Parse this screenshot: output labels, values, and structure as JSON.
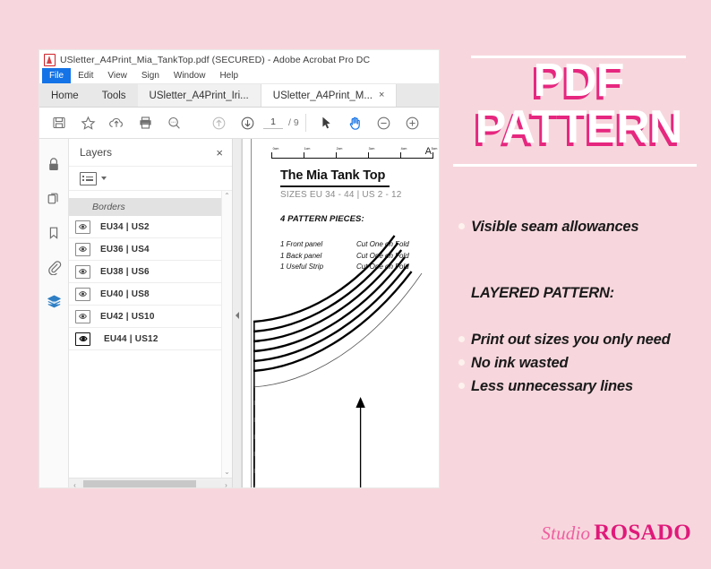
{
  "canvas": {
    "bg_color": "#f7d7dd"
  },
  "acrobat": {
    "titlebar": {
      "icon": "acrobat-logo",
      "text": "USletter_A4Print_Mia_TankTop.pdf (SECURED) - Adobe Acrobat Pro DC"
    },
    "menu": [
      {
        "label": "File",
        "active": true
      },
      {
        "label": "Edit",
        "active": false
      },
      {
        "label": "View",
        "active": false
      },
      {
        "label": "Sign",
        "active": false
      },
      {
        "label": "Window",
        "active": false
      },
      {
        "label": "Help",
        "active": false
      }
    ],
    "tabs": [
      {
        "label": "Home",
        "type": "flat",
        "active": false,
        "closable": false
      },
      {
        "label": "Tools",
        "type": "flat",
        "active": false,
        "closable": false
      },
      {
        "label": "USletter_A4Print_Iri...",
        "type": "doc",
        "active": false,
        "closable": false
      },
      {
        "label": "USletter_A4Print_M...",
        "type": "doc",
        "active": true,
        "closable": true,
        "close_glyph": "×"
      }
    ],
    "toolbar": {
      "icons": [
        "save-icon",
        "star-icon",
        "cloud-upload-icon",
        "print-icon",
        "search-icon",
        "page-up-icon",
        "page-down-icon"
      ],
      "page_current": "1",
      "page_total": "/ 9",
      "tools": [
        {
          "name": "select-tool",
          "active": false
        },
        {
          "name": "hand-tool",
          "active": true
        },
        {
          "name": "zoom-out-tool",
          "active": false
        },
        {
          "name": "zoom-in-tool",
          "active": false
        }
      ],
      "accent_color": "#1473e6"
    },
    "rail": [
      {
        "name": "lock-icon",
        "selected": false
      },
      {
        "name": "page-thumbnails-icon",
        "selected": false
      },
      {
        "name": "bookmark-icon",
        "selected": false
      },
      {
        "name": "attachment-icon",
        "selected": false
      },
      {
        "name": "layers-icon",
        "selected": true
      }
    ],
    "layers_panel": {
      "title": "Layers",
      "close_glyph": "×",
      "options_icon": "list-options-icon",
      "group_label": "Borders",
      "layers": [
        {
          "label": "EU34 | US2",
          "visible": true,
          "highlight": false
        },
        {
          "label": "EU36 | US4",
          "visible": true,
          "highlight": false
        },
        {
          "label": "EU38 | US6",
          "visible": true,
          "highlight": false
        },
        {
          "label": "EU40 | US8",
          "visible": true,
          "highlight": false
        },
        {
          "label": "EU42 | US10",
          "visible": true,
          "highlight": false
        },
        {
          "label": "EU44 | US12",
          "visible": true,
          "highlight": true
        }
      ],
      "scroll": {
        "up_glyph": "⌃",
        "down_glyph": "⌄",
        "left_glyph": "‹",
        "right_glyph": "›"
      }
    },
    "document": {
      "ruler_labels": [
        "0cm",
        "1cm",
        "2cm",
        "3cm",
        "4cm",
        "5cm"
      ],
      "page_letter": "A",
      "title": "The Mia Tank Top",
      "sizes": "SIZES EU 34 - 44 | US 2 - 12",
      "pieces_heading": "4 PATTERN PIECES:",
      "pieces": [
        {
          "qty": "1 Front panel",
          "instruction": "Cut One on Fold"
        },
        {
          "qty": "1 Back panel",
          "instruction": "Cut One on Fold"
        },
        {
          "qty": "1 Useful Strip",
          "instruction": "Cut One on Fold"
        }
      ]
    }
  },
  "promo": {
    "heading_line1": "PDF",
    "heading_line2": "PATTERN",
    "heading_color": "#ffffff",
    "heading_shadow_color": "#e6277f",
    "bullets_top": [
      "Visible seam allowances"
    ],
    "subheading": "LAYERED PATTERN:",
    "bullets_bottom": [
      "Print out sizes you only need",
      "No ink wasted",
      "Less unnecessary lines"
    ],
    "brand": {
      "word1": "Studio",
      "word2": "ROSADO",
      "color1": "#ef5ea0",
      "color2": "#e0197a"
    }
  }
}
